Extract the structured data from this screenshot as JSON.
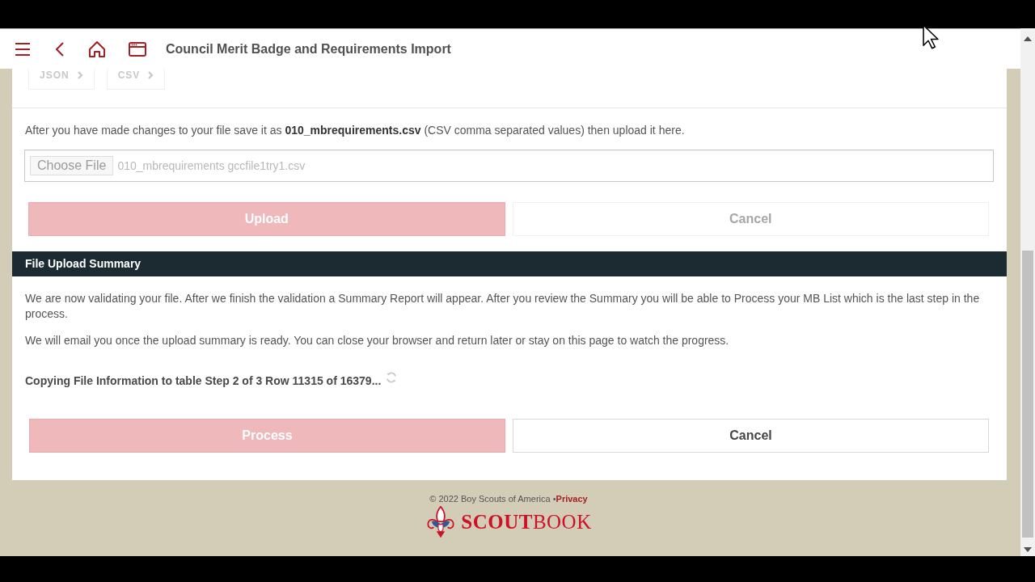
{
  "header": {
    "title": "Council Merit Badge and Requirements Import"
  },
  "format_tabs": [
    {
      "label": "JSON",
      "disabled": true
    },
    {
      "label": "CSV",
      "disabled": true
    }
  ],
  "upload": {
    "instruction": "After you have made changes to your file save it as **010_mbrequirements.csv** (CSV comma separated values) then upload it here.",
    "file_input": {
      "button": "Choose File",
      "value": "010_mbrequirements gccfile1try1.csv",
      "disabled": true
    },
    "buttons": [
      {
        "label": "Upload",
        "kind": "primary",
        "disabled": true
      },
      {
        "label": "Cancel",
        "kind": "secondary",
        "disabled": true
      }
    ]
  },
  "summary": {
    "title": "File Upload Summary",
    "paragraphs": [
      "We are now validating your file. After we finish the validation a Summary Report will appear. After you review the Summary you will be able to Process your MB List which is the last step in the process.",
      "We will email you once the upload summary is ready. You can close your browser and return later or stay on this page to watch the progress."
    ],
    "progress": "Copying File Information to table Step 2 of 3 Row 11315 of 16379...",
    "buttons": [
      {
        "label": "Process",
        "kind": "primary",
        "disabled": true
      },
      {
        "label": "Cancel",
        "kind": "secondary",
        "disabled": false
      }
    ]
  },
  "footer": {
    "copyright": "© 2022 Boy Scouts of America •",
    "privacy_link": "Privacy",
    "brand": "**SCOUT**BOOK"
  }
}
